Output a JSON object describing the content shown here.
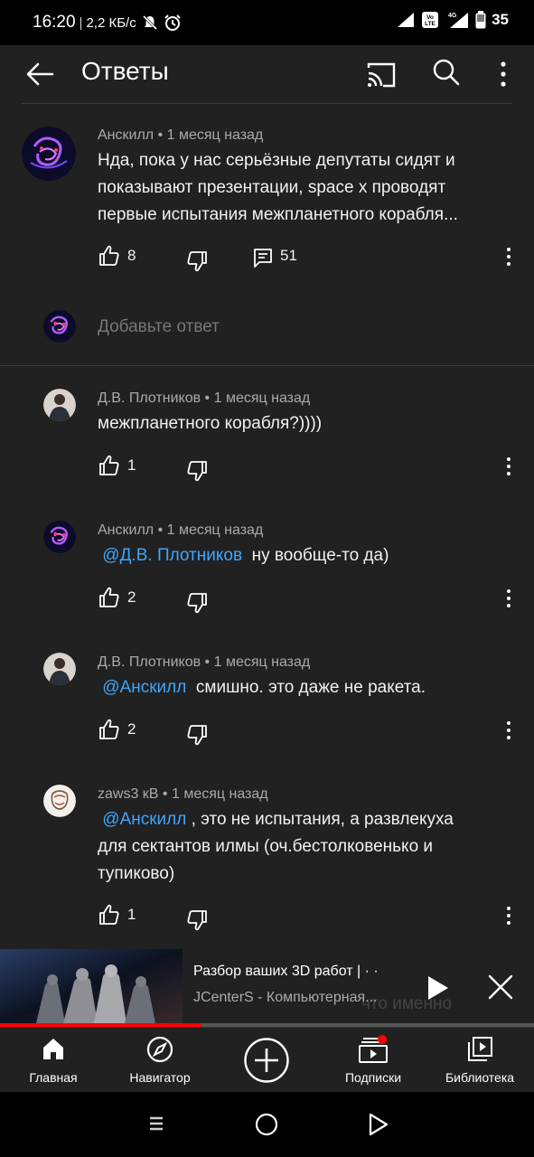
{
  "status_bar": {
    "time": "16:20",
    "speed": "2,2 КБ/с",
    "battery": "35"
  },
  "header": {
    "title": "Ответы"
  },
  "parent_comment": {
    "author": "Анскилл",
    "age": "1 месяц назад",
    "text_lines": [
      "Нда, пока у нас серьёзные депутаты сидят и",
      "показывают презентации, space x проводят",
      "первые испытания межпланетного корабля..."
    ],
    "likes": "8",
    "replies": "51"
  },
  "add_reply": {
    "placeholder": "Добавьте ответ"
  },
  "replies": [
    {
      "author": "Д.В. Плотников",
      "age": "1 месяц назад",
      "mention": "",
      "text_lines": [
        "межпланетного корабля?))))"
      ],
      "likes": "1"
    },
    {
      "author": "Анскилл",
      "age": "1 месяц назад",
      "mention": "@Д.В. Плотников",
      "text_lines": [
        "ну вообще-то да)"
      ],
      "likes": "2"
    },
    {
      "author": "Д.В. Плотников",
      "age": "1 месяц назад",
      "mention": "@Анскилл",
      "text_lines": [
        "смишно. это даже не ракета."
      ],
      "likes": "2"
    },
    {
      "author": "zaws3 кВ",
      "age": "1 месяц назад",
      "mention": "@Анскилл",
      "text_lines": [
        ", это не испытания, а развлекуха",
        "для сектантов илмы (оч.бестолковенько и",
        "тупиково)"
      ],
      "likes": "1"
    }
  ],
  "mini_player": {
    "title": "Разбор ваших 3D работ | · ·",
    "channel": "JCenterS - Компьютерная...",
    "ghost_text": "что именно",
    "progress": 0.377
  },
  "bottom_nav": [
    {
      "label": "Главная",
      "icon": "home-icon"
    },
    {
      "label": "Навигатор",
      "icon": "compass-icon"
    },
    {
      "label": "",
      "icon": "create-icon"
    },
    {
      "label": "Подписки",
      "icon": "subscriptions-icon"
    },
    {
      "label": "Библиотека",
      "icon": "library-icon"
    }
  ],
  "colors": {
    "background": "#212121",
    "mention": "#3ea6ff",
    "accent": "#ff0000"
  }
}
